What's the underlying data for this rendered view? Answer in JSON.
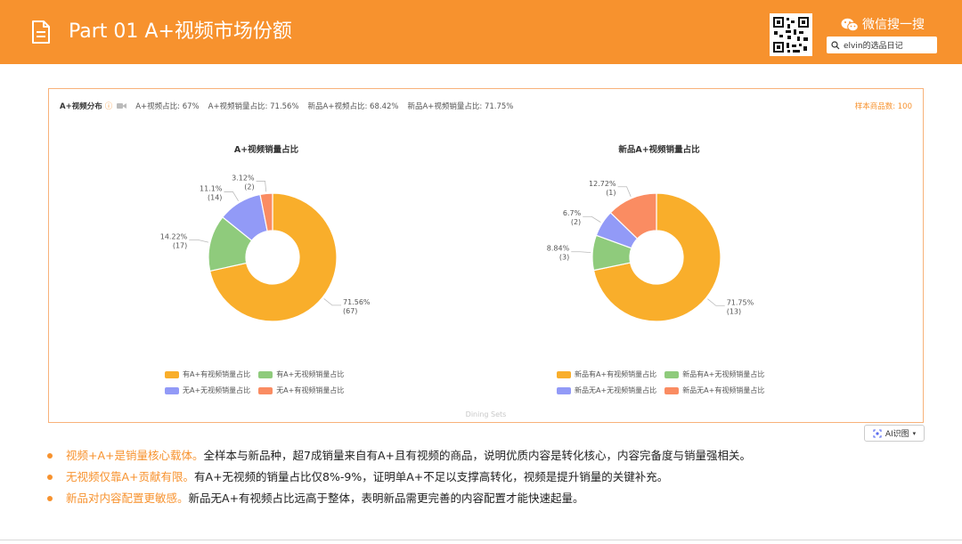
{
  "header": {
    "title": "Part 01  A+视频市场份额",
    "wechat_label": "微信搜一搜",
    "search_value": "elvin的选品日记",
    "icons": [
      "document-icon",
      "qr-code",
      "wechat-icon",
      "search-icon"
    ]
  },
  "panel": {
    "stats_label": "A+视频分布",
    "stats": [
      "A+视频占比: 67%",
      "A+视频销量占比: 71.56%",
      "新品A+视频占比: 68.42%",
      "新品A+视频销量占比: 71.75%"
    ],
    "sample_count": "样本商品数: 100",
    "footer_label": "Dining Sets"
  },
  "colors": {
    "accent": "#f7922e",
    "series": [
      "#f9ae2b",
      "#8fcb7c",
      "#929af7",
      "#fa8c62"
    ]
  },
  "chart_data": [
    {
      "type": "pie",
      "title": "A+视频销量占比",
      "categories": [
        "有A+有视频销量占比",
        "有A+无视频销量占比",
        "无A+无视频销量占比",
        "无A+有视频销量占比"
      ],
      "values": [
        71.56,
        14.22,
        11.1,
        3.12
      ],
      "counts": [
        67,
        17,
        14,
        2
      ],
      "percent_labels": [
        "71.56%",
        "14.22%",
        "11.1%",
        "3.12%"
      ],
      "count_labels": [
        "(67)",
        "(17)",
        "(14)",
        "(2)"
      ],
      "donut": true,
      "legend": "bottom"
    },
    {
      "type": "pie",
      "title": "新品A+视频销量占比",
      "categories": [
        "新品有A+有视频销量占比",
        "新品有A+无视频销量占比",
        "新品无A+无视频销量占比",
        "新品无A+有视频销量占比"
      ],
      "values": [
        71.75,
        8.84,
        6.7,
        12.72
      ],
      "counts": [
        13,
        3,
        2,
        1
      ],
      "percent_labels": [
        "71.75%",
        "8.84%",
        "6.7%",
        "12.72%"
      ],
      "count_labels": [
        "(13)",
        "(3)",
        "(2)",
        "(1)"
      ],
      "donut": true,
      "legend": "bottom"
    }
  ],
  "ai_button": "AI识图",
  "bullets": [
    {
      "highlight": "视频+A+是销量核心载体。",
      "text": "全样本与新品种，超7成销量来自有A+且有视频的商品，说明优质内容是转化核心，内容完备度与销量强相关。"
    },
    {
      "highlight": "无视频仅靠A+贡献有限。",
      "text": "有A+无视频的销量占比仅8%-9%，证明单A+不足以支撑高转化，视频是提升销量的关键补充。"
    },
    {
      "highlight": "新品对内容配置更敏感。",
      "text": "新品无A+有视频占比远高于整体，表明新品需更完善的内容配置才能快速起量。"
    }
  ]
}
